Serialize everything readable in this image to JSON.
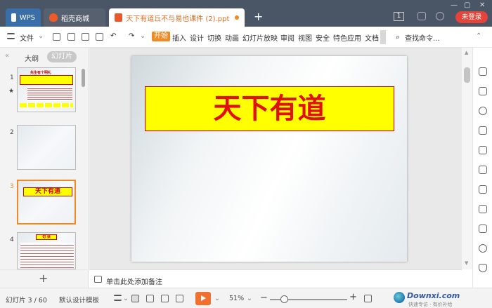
{
  "titlebar": {
    "tabs": [
      {
        "label": "WPS"
      },
      {
        "label": "稻壳商城"
      },
      {
        "label": "天下有道丘不与易也课件 (2).ppt"
      }
    ],
    "window_badge": "1",
    "login_label": "未登录"
  },
  "menubar": {
    "file_label": "文件",
    "items": [
      "开始",
      "插入",
      "设计",
      "切换",
      "动画",
      "幻灯片放映",
      "审阅",
      "视图",
      "安全",
      "特色应用",
      "文档"
    ],
    "search_label": "查找命令..."
  },
  "sidebar": {
    "outline_tab": "大纲",
    "slides_tab": "幻灯片",
    "thumbnails": [
      {
        "num": "1",
        "title": "先生有个明礼"
      },
      {
        "num": "2",
        "title": ""
      },
      {
        "num": "3",
        "title": "天下有道"
      },
      {
        "num": "4",
        "title": "句 读"
      }
    ]
  },
  "slide": {
    "title": "天下有道"
  },
  "notes": {
    "placeholder": "单击此处添加备注"
  },
  "statusbar": {
    "slide_counter": "幻灯片 3 / 60",
    "template": "默认设计模板",
    "zoom": "51%",
    "watermark_text": "Downxi.com",
    "watermark_sub": "快速专访 · 有价补给"
  },
  "colors": {
    "accent": "#f08a24",
    "title_bg": "#ffff00",
    "title_text": "#e01010",
    "login_bg": "#e6433a"
  }
}
